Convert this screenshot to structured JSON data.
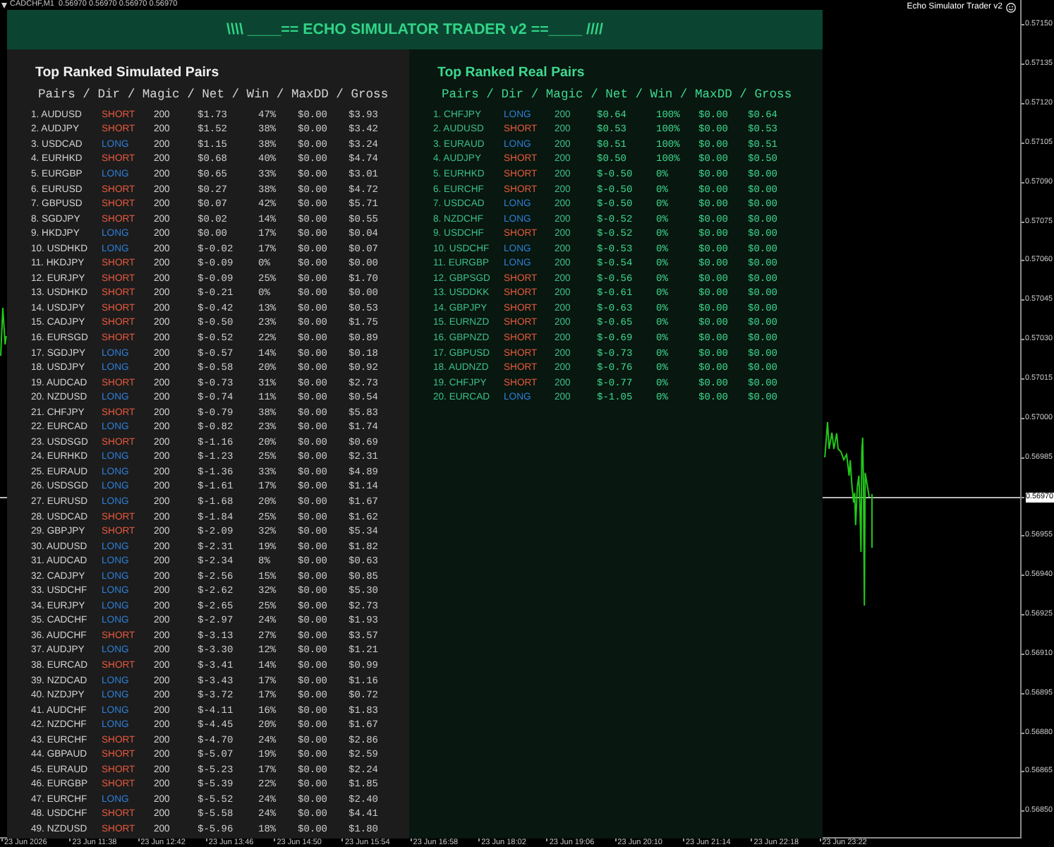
{
  "chart": {
    "symbol_caption": "CADCHF,M1  0.56970 0.56970 0.56970 0.56970",
    "indicator_name": "Echo Simulator Trader v2"
  },
  "panel": {
    "title": "\\\\\\\\ ____== ECHO SIMULATOR TRADER v2 ==____ ////",
    "sections": [
      {
        "kind": "simulated",
        "title": "Top Ranked Simulated Pairs",
        "columns_header": "Pairs / Dir / Magic / Net / Win / MaxDD / Gross",
        "rows": [
          {
            "pair": "1. AUDUSD",
            "dir": {
              "text": "SHORT",
              "color": "#e65a3e"
            },
            "magic": "200",
            "net": "$1.73",
            "win": "47%",
            "max_dd": "$0.00",
            "gross": "$3.93"
          },
          {
            "pair": "2. AUDJPY",
            "dir": {
              "text": "SHORT",
              "color": "#e65a3e"
            },
            "magic": "200",
            "net": "$1.52",
            "win": "38%",
            "max_dd": "$0.00",
            "gross": "$3.42"
          },
          {
            "pair": "3. USDCAD",
            "dir": {
              "text": "LONG",
              "color": "#2e7fd6"
            },
            "magic": "200",
            "net": "$1.15",
            "win": "38%",
            "max_dd": "$0.00",
            "gross": "$3.24"
          },
          {
            "pair": "4. EURHKD",
            "dir": {
              "text": "SHORT",
              "color": "#e65a3e"
            },
            "magic": "200",
            "net": "$0.68",
            "win": "40%",
            "max_dd": "$0.00",
            "gross": "$4.74"
          },
          {
            "pair": "5. EURGBP",
            "dir": {
              "text": "LONG",
              "color": "#2e7fd6"
            },
            "magic": "200",
            "net": "$0.65",
            "win": "33%",
            "max_dd": "$0.00",
            "gross": "$3.01"
          },
          {
            "pair": "6. EURUSD",
            "dir": {
              "text": "SHORT",
              "color": "#e65a3e"
            },
            "magic": "200",
            "net": "$0.27",
            "win": "38%",
            "max_dd": "$0.00",
            "gross": "$4.72"
          },
          {
            "pair": "7. GBPUSD",
            "dir": {
              "text": "SHORT",
              "color": "#e65a3e"
            },
            "magic": "200",
            "net": "$0.07",
            "win": "42%",
            "max_dd": "$0.00",
            "gross": "$5.71"
          },
          {
            "pair": "8. SGDJPY",
            "dir": {
              "text": "SHORT",
              "color": "#e65a3e"
            },
            "magic": "200",
            "net": "$0.02",
            "win": "14%",
            "max_dd": "$0.00",
            "gross": "$0.55"
          },
          {
            "pair": "9. HKDJPY",
            "dir": {
              "text": "LONG",
              "color": "#2e7fd6"
            },
            "magic": "200",
            "net": "$0.00",
            "win": "17%",
            "max_dd": "$0.00",
            "gross": "$0.04"
          },
          {
            "pair": "10. USDHKD",
            "dir": {
              "text": "LONG",
              "color": "#2e7fd6"
            },
            "magic": "200",
            "net": "$-0.02",
            "win": "17%",
            "max_dd": "$0.00",
            "gross": "$0.07"
          },
          {
            "pair": "11. HKDJPY",
            "dir": {
              "text": "SHORT",
              "color": "#e65a3e"
            },
            "magic": "200",
            "net": "$-0.09",
            "win": "0%",
            "max_dd": "$0.00",
            "gross": "$0.00"
          },
          {
            "pair": "12. EURJPY",
            "dir": {
              "text": "SHORT",
              "color": "#e65a3e"
            },
            "magic": "200",
            "net": "$-0.09",
            "win": "25%",
            "max_dd": "$0.00",
            "gross": "$1.70"
          },
          {
            "pair": "13. USDHKD",
            "dir": {
              "text": "SHORT",
              "color": "#e65a3e"
            },
            "magic": "200",
            "net": "$-0.21",
            "win": "0%",
            "max_dd": "$0.00",
            "gross": "$0.00"
          },
          {
            "pair": "14. USDJPY",
            "dir": {
              "text": "SHORT",
              "color": "#e65a3e"
            },
            "magic": "200",
            "net": "$-0.42",
            "win": "13%",
            "max_dd": "$0.00",
            "gross": "$0.53"
          },
          {
            "pair": "15. CADJPY",
            "dir": {
              "text": "SHORT",
              "color": "#e65a3e"
            },
            "magic": "200",
            "net": "$-0.50",
            "win": "23%",
            "max_dd": "$0.00",
            "gross": "$1.75"
          },
          {
            "pair": "16. EURSGD",
            "dir": {
              "text": "SHORT",
              "color": "#e65a3e"
            },
            "magic": "200",
            "net": "$-0.52",
            "win": "22%",
            "max_dd": "$0.00",
            "gross": "$0.89"
          },
          {
            "pair": "17. SGDJPY",
            "dir": {
              "text": "LONG",
              "color": "#2e7fd6"
            },
            "magic": "200",
            "net": "$-0.57",
            "win": "14%",
            "max_dd": "$0.00",
            "gross": "$0.18"
          },
          {
            "pair": "18. USDJPY",
            "dir": {
              "text": "LONG",
              "color": "#2e7fd6"
            },
            "magic": "200",
            "net": "$-0.58",
            "win": "20%",
            "max_dd": "$0.00",
            "gross": "$0.92"
          },
          {
            "pair": "19. AUDCAD",
            "dir": {
              "text": "SHORT",
              "color": "#e65a3e"
            },
            "magic": "200",
            "net": "$-0.73",
            "win": "31%",
            "max_dd": "$0.00",
            "gross": "$2.73"
          },
          {
            "pair": "20. NZDUSD",
            "dir": {
              "text": "LONG",
              "color": "#2e7fd6"
            },
            "magic": "200",
            "net": "$-0.74",
            "win": "11%",
            "max_dd": "$0.00",
            "gross": "$0.54"
          },
          {
            "pair": "21. CHFJPY",
            "dir": {
              "text": "SHORT",
              "color": "#e65a3e"
            },
            "magic": "200",
            "net": "$-0.79",
            "win": "38%",
            "max_dd": "$0.00",
            "gross": "$5.83"
          },
          {
            "pair": "22. EURCAD",
            "dir": {
              "text": "LONG",
              "color": "#2e7fd6"
            },
            "magic": "200",
            "net": "$-0.82",
            "win": "23%",
            "max_dd": "$0.00",
            "gross": "$1.74"
          },
          {
            "pair": "23. USDSGD",
            "dir": {
              "text": "SHORT",
              "color": "#e65a3e"
            },
            "magic": "200",
            "net": "$-1.16",
            "win": "20%",
            "max_dd": "$0.00",
            "gross": "$0.69"
          },
          {
            "pair": "24. EURHKD",
            "dir": {
              "text": "LONG",
              "color": "#2e7fd6"
            },
            "magic": "200",
            "net": "$-1.23",
            "win": "25%",
            "max_dd": "$0.00",
            "gross": "$2.31"
          },
          {
            "pair": "25. EURAUD",
            "dir": {
              "text": "LONG",
              "color": "#2e7fd6"
            },
            "magic": "200",
            "net": "$-1.36",
            "win": "33%",
            "max_dd": "$0.00",
            "gross": "$4.89"
          },
          {
            "pair": "26. USDSGD",
            "dir": {
              "text": "LONG",
              "color": "#2e7fd6"
            },
            "magic": "200",
            "net": "$-1.61",
            "win": "17%",
            "max_dd": "$0.00",
            "gross": "$1.14"
          },
          {
            "pair": "27. EURUSD",
            "dir": {
              "text": "LONG",
              "color": "#2e7fd6"
            },
            "magic": "200",
            "net": "$-1.68",
            "win": "20%",
            "max_dd": "$0.00",
            "gross": "$1.67"
          },
          {
            "pair": "28. USDCAD",
            "dir": {
              "text": "SHORT",
              "color": "#e65a3e"
            },
            "magic": "200",
            "net": "$-1.84",
            "win": "25%",
            "max_dd": "$0.00",
            "gross": "$1.62"
          },
          {
            "pair": "29. GBPJPY",
            "dir": {
              "text": "SHORT",
              "color": "#e65a3e"
            },
            "magic": "200",
            "net": "$-2.09",
            "win": "32%",
            "max_dd": "$0.00",
            "gross": "$5.34"
          },
          {
            "pair": "30. AUDUSD",
            "dir": {
              "text": "LONG",
              "color": "#2e7fd6"
            },
            "magic": "200",
            "net": "$-2.31",
            "win": "19%",
            "max_dd": "$0.00",
            "gross": "$1.82"
          },
          {
            "pair": "31. AUDCAD",
            "dir": {
              "text": "LONG",
              "color": "#2e7fd6"
            },
            "magic": "200",
            "net": "$-2.34",
            "win": "8%",
            "max_dd": "$0.00",
            "gross": "$0.63"
          },
          {
            "pair": "32. CADJPY",
            "dir": {
              "text": "LONG",
              "color": "#2e7fd6"
            },
            "magic": "200",
            "net": "$-2.56",
            "win": "15%",
            "max_dd": "$0.00",
            "gross": "$0.85"
          },
          {
            "pair": "33. USDCHF",
            "dir": {
              "text": "LONG",
              "color": "#2e7fd6"
            },
            "magic": "200",
            "net": "$-2.62",
            "win": "32%",
            "max_dd": "$0.00",
            "gross": "$5.30"
          },
          {
            "pair": "34. EURJPY",
            "dir": {
              "text": "LONG",
              "color": "#2e7fd6"
            },
            "magic": "200",
            "net": "$-2.65",
            "win": "25%",
            "max_dd": "$0.00",
            "gross": "$2.73"
          },
          {
            "pair": "35. CADCHF",
            "dir": {
              "text": "LONG",
              "color": "#2e7fd6"
            },
            "magic": "200",
            "net": "$-2.97",
            "win": "24%",
            "max_dd": "$0.00",
            "gross": "$1.93"
          },
          {
            "pair": "36. AUDCHF",
            "dir": {
              "text": "SHORT",
              "color": "#e65a3e"
            },
            "magic": "200",
            "net": "$-3.13",
            "win": "27%",
            "max_dd": "$0.00",
            "gross": "$3.57"
          },
          {
            "pair": "37. AUDJPY",
            "dir": {
              "text": "LONG",
              "color": "#2e7fd6"
            },
            "magic": "200",
            "net": "$-3.30",
            "win": "12%",
            "max_dd": "$0.00",
            "gross": "$1.21"
          },
          {
            "pair": "38. EURCAD",
            "dir": {
              "text": "SHORT",
              "color": "#e65a3e"
            },
            "magic": "200",
            "net": "$-3.41",
            "win": "14%",
            "max_dd": "$0.00",
            "gross": "$0.99"
          },
          {
            "pair": "39. NZDCAD",
            "dir": {
              "text": "LONG",
              "color": "#2e7fd6"
            },
            "magic": "200",
            "net": "$-3.43",
            "win": "17%",
            "max_dd": "$0.00",
            "gross": "$1.16"
          },
          {
            "pair": "40. NZDJPY",
            "dir": {
              "text": "LONG",
              "color": "#2e7fd6"
            },
            "magic": "200",
            "net": "$-3.72",
            "win": "17%",
            "max_dd": "$0.00",
            "gross": "$0.72"
          },
          {
            "pair": "41. AUDCHF",
            "dir": {
              "text": "LONG",
              "color": "#2e7fd6"
            },
            "magic": "200",
            "net": "$-4.11",
            "win": "16%",
            "max_dd": "$0.00",
            "gross": "$1.83"
          },
          {
            "pair": "42. NZDCHF",
            "dir": {
              "text": "LONG",
              "color": "#2e7fd6"
            },
            "magic": "200",
            "net": "$-4.45",
            "win": "20%",
            "max_dd": "$0.00",
            "gross": "$1.67"
          },
          {
            "pair": "43. EURCHF",
            "dir": {
              "text": "SHORT",
              "color": "#e65a3e"
            },
            "magic": "200",
            "net": "$-4.70",
            "win": "24%",
            "max_dd": "$0.00",
            "gross": "$2.86"
          },
          {
            "pair": "44. GBPAUD",
            "dir": {
              "text": "SHORT",
              "color": "#e65a3e"
            },
            "magic": "200",
            "net": "$-5.07",
            "win": "19%",
            "max_dd": "$0.00",
            "gross": "$2.59"
          },
          {
            "pair": "45. EURAUD",
            "dir": {
              "text": "SHORT",
              "color": "#e65a3e"
            },
            "magic": "200",
            "net": "$-5.23",
            "win": "17%",
            "max_dd": "$0.00",
            "gross": "$2.24"
          },
          {
            "pair": "46. EURGBP",
            "dir": {
              "text": "SHORT",
              "color": "#e65a3e"
            },
            "magic": "200",
            "net": "$-5.39",
            "win": "22%",
            "max_dd": "$0.00",
            "gross": "$1.85"
          },
          {
            "pair": "47. EURCHF",
            "dir": {
              "text": "LONG",
              "color": "#2e7fd6"
            },
            "magic": "200",
            "net": "$-5.52",
            "win": "24%",
            "max_dd": "$0.00",
            "gross": "$2.40"
          },
          {
            "pair": "48. USDCHF",
            "dir": {
              "text": "SHORT",
              "color": "#e65a3e"
            },
            "magic": "200",
            "net": "$-5.58",
            "win": "24%",
            "max_dd": "$0.00",
            "gross": "$4.41"
          },
          {
            "pair": "49. NZDUSD",
            "dir": {
              "text": "SHORT",
              "color": "#e65a3e"
            },
            "magic": "200",
            "net": "$-5.96",
            "win": "18%",
            "max_dd": "$0.00",
            "gross": "$1.80"
          }
        ]
      },
      {
        "kind": "real",
        "title": "Top Ranked Real Pairs",
        "columns_header": "Pairs / Dir / Magic / Net / Win / MaxDD / Gross",
        "rows": [
          {
            "pair": "1. CHFJPY",
            "dir": {
              "text": "LONG",
              "color": "#2e7fd6"
            },
            "magic": "200",
            "net": "$0.64",
            "win": "100%",
            "max_dd": "$0.00",
            "gross": "$0.64"
          },
          {
            "pair": "2. AUDUSD",
            "dir": {
              "text": "SHORT",
              "color": "#e65a3e"
            },
            "magic": "200",
            "net": "$0.53",
            "win": "100%",
            "max_dd": "$0.00",
            "gross": "$0.53"
          },
          {
            "pair": "3. EURAUD",
            "dir": {
              "text": "LONG",
              "color": "#2e7fd6"
            },
            "magic": "200",
            "net": "$0.51",
            "win": "100%",
            "max_dd": "$0.00",
            "gross": "$0.51"
          },
          {
            "pair": "4. AUDJPY",
            "dir": {
              "text": "SHORT",
              "color": "#e65a3e"
            },
            "magic": "200",
            "net": "$0.50",
            "win": "100%",
            "max_dd": "$0.00",
            "gross": "$0.50"
          },
          {
            "pair": "5. EURHKD",
            "dir": {
              "text": "SHORT",
              "color": "#e65a3e"
            },
            "magic": "200",
            "net": "$-0.50",
            "win": "0%",
            "max_dd": "$0.00",
            "gross": "$0.00"
          },
          {
            "pair": "6. EURCHF",
            "dir": {
              "text": "SHORT",
              "color": "#e65a3e"
            },
            "magic": "200",
            "net": "$-0.50",
            "win": "0%",
            "max_dd": "$0.00",
            "gross": "$0.00"
          },
          {
            "pair": "7. USDCAD",
            "dir": {
              "text": "LONG",
              "color": "#2e7fd6"
            },
            "magic": "200",
            "net": "$-0.50",
            "win": "0%",
            "max_dd": "$0.00",
            "gross": "$0.00"
          },
          {
            "pair": "8. NZDCHF",
            "dir": {
              "text": "LONG",
              "color": "#2e7fd6"
            },
            "magic": "200",
            "net": "$-0.52",
            "win": "0%",
            "max_dd": "$0.00",
            "gross": "$0.00"
          },
          {
            "pair": "9. USDCHF",
            "dir": {
              "text": "SHORT",
              "color": "#e65a3e"
            },
            "magic": "200",
            "net": "$-0.52",
            "win": "0%",
            "max_dd": "$0.00",
            "gross": "$0.00"
          },
          {
            "pair": "10. USDCHF",
            "dir": {
              "text": "LONG",
              "color": "#2e7fd6"
            },
            "magic": "200",
            "net": "$-0.53",
            "win": "0%",
            "max_dd": "$0.00",
            "gross": "$0.00"
          },
          {
            "pair": "11. EURGBP",
            "dir": {
              "text": "LONG",
              "color": "#2e7fd6"
            },
            "magic": "200",
            "net": "$-0.54",
            "win": "0%",
            "max_dd": "$0.00",
            "gross": "$0.00"
          },
          {
            "pair": "12. GBPSGD",
            "dir": {
              "text": "SHORT",
              "color": "#e65a3e"
            },
            "magic": "200",
            "net": "$-0.56",
            "win": "0%",
            "max_dd": "$0.00",
            "gross": "$0.00"
          },
          {
            "pair": "13. USDDKK",
            "dir": {
              "text": "SHORT",
              "color": "#e65a3e"
            },
            "magic": "200",
            "net": "$-0.61",
            "win": "0%",
            "max_dd": "$0.00",
            "gross": "$0.00"
          },
          {
            "pair": "14. GBPJPY",
            "dir": {
              "text": "SHORT",
              "color": "#e65a3e"
            },
            "magic": "200",
            "net": "$-0.63",
            "win": "0%",
            "max_dd": "$0.00",
            "gross": "$0.00"
          },
          {
            "pair": "15. EURNZD",
            "dir": {
              "text": "SHORT",
              "color": "#e65a3e"
            },
            "magic": "200",
            "net": "$-0.65",
            "win": "0%",
            "max_dd": "$0.00",
            "gross": "$0.00"
          },
          {
            "pair": "16. GBPNZD",
            "dir": {
              "text": "SHORT",
              "color": "#e65a3e"
            },
            "magic": "200",
            "net": "$-0.69",
            "win": "0%",
            "max_dd": "$0.00",
            "gross": "$0.00"
          },
          {
            "pair": "17. GBPUSD",
            "dir": {
              "text": "SHORT",
              "color": "#e65a3e"
            },
            "magic": "200",
            "net": "$-0.73",
            "win": "0%",
            "max_dd": "$0.00",
            "gross": "$0.00"
          },
          {
            "pair": "18. AUDNZD",
            "dir": {
              "text": "SHORT",
              "color": "#e65a3e"
            },
            "magic": "200",
            "net": "$-0.76",
            "win": "0%",
            "max_dd": "$0.00",
            "gross": "$0.00"
          },
          {
            "pair": "19. CHFJPY",
            "dir": {
              "text": "SHORT",
              "color": "#e65a3e"
            },
            "magic": "200",
            "net": "$-0.77",
            "win": "0%",
            "max_dd": "$0.00",
            "gross": "$0.00"
          },
          {
            "pair": "20. EURCAD",
            "dir": {
              "text": "LONG",
              "color": "#2e7fd6"
            },
            "magic": "200",
            "net": "$-1.05",
            "win": "0%",
            "max_dd": "$0.00",
            "gross": "$0.00"
          }
        ]
      }
    ]
  },
  "price_axis": {
    "labels": [
      {
        "text": "0.57150",
        "kind": "tick"
      },
      {
        "text": "0.57135",
        "kind": "tick"
      },
      {
        "text": "0.57120",
        "kind": "tick"
      },
      {
        "text": "0.57105",
        "kind": "tick"
      },
      {
        "text": "0.57090",
        "kind": "tick"
      },
      {
        "text": "0.57075",
        "kind": "tick"
      },
      {
        "text": "0.57060",
        "kind": "tick"
      },
      {
        "text": "0.57045",
        "kind": "tick"
      },
      {
        "text": "0.57030",
        "kind": "tick"
      },
      {
        "text": "0.57015",
        "kind": "tick"
      },
      {
        "text": "0.57000",
        "kind": "tick"
      },
      {
        "text": "0.56985",
        "kind": "tick"
      },
      {
        "text": "0.56970",
        "kind": "current"
      },
      {
        "text": "0.56955",
        "kind": "tick"
      },
      {
        "text": "0.56940",
        "kind": "tick"
      },
      {
        "text": "0.56925",
        "kind": "tick"
      },
      {
        "text": "0.56910",
        "kind": "tick"
      },
      {
        "text": "0.56895",
        "kind": "tick"
      },
      {
        "text": "0.56880",
        "kind": "tick"
      },
      {
        "text": "0.56865",
        "kind": "tick"
      },
      {
        "text": "0.56850",
        "kind": "tick"
      }
    ]
  },
  "time_axis": {
    "labels": [
      "23 Jun 2026",
      "23 Jun 11:38",
      "23 Jun 12:42",
      "23 Jun 13:46",
      "23 Jun 14:50",
      "23 Jun 15:54",
      "23 Jun 16:58",
      "23 Jun 18:02",
      "23 Jun 19:06",
      "23 Jun 20:10",
      "23 Jun 21:14",
      "23 Jun 22:18",
      "23 Jun 23:22"
    ]
  }
}
